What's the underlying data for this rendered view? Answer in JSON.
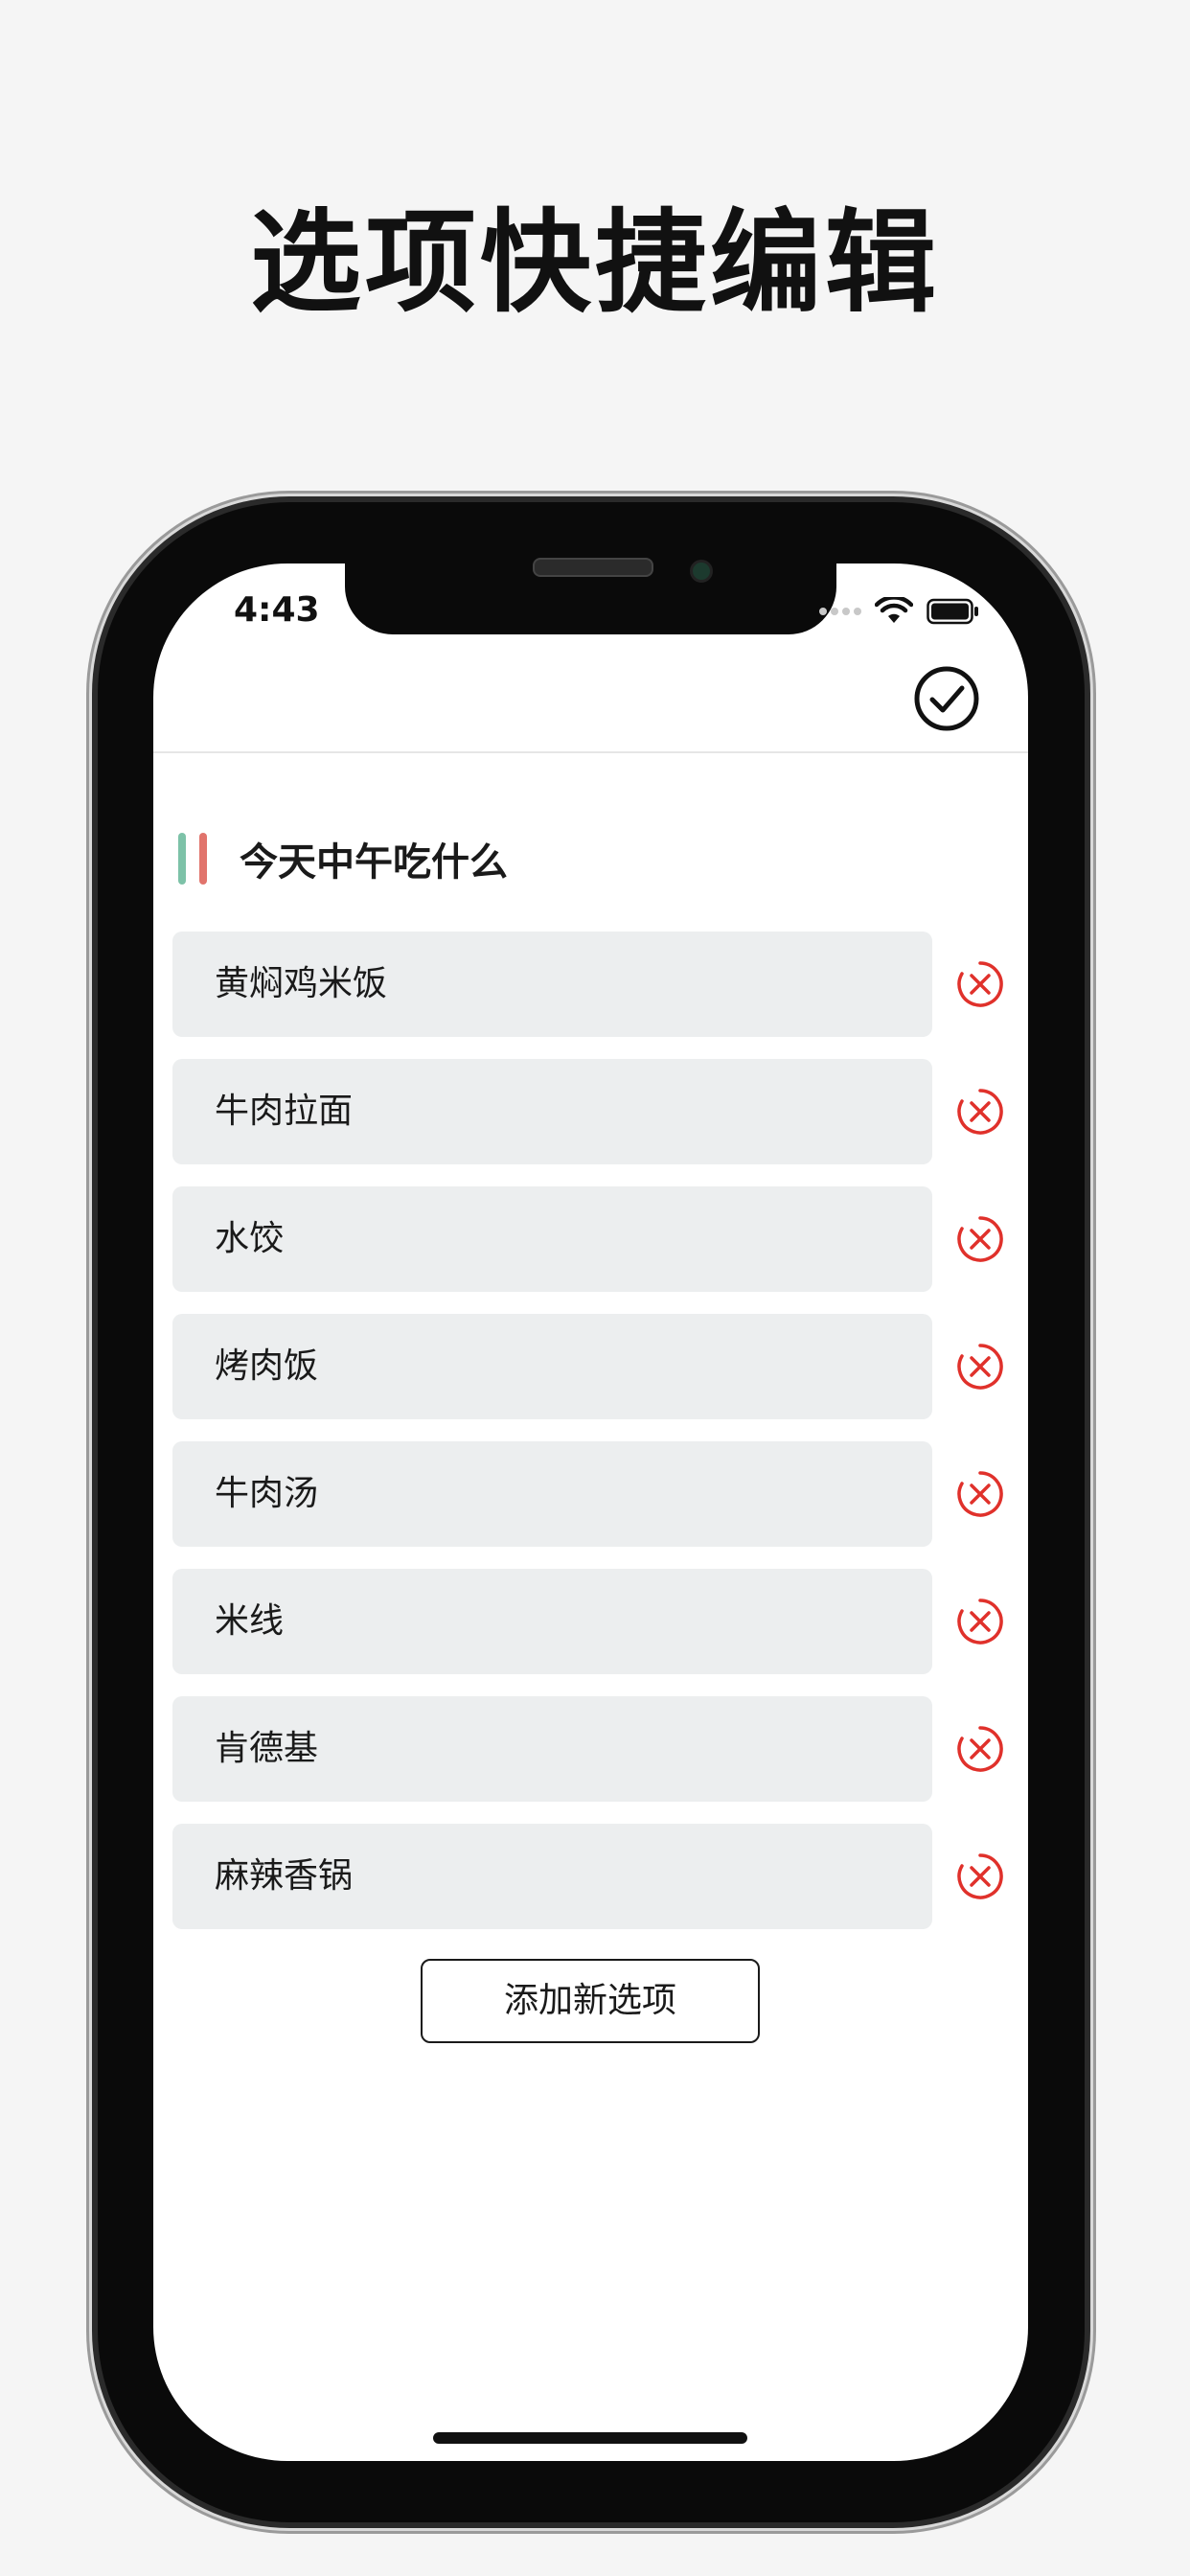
{
  "headline": "选项快捷编辑",
  "status_bar": {
    "time": "4:43"
  },
  "list": {
    "title": "今天中午吃什么",
    "marker_colors": [
      "#7dc2a8",
      "#e1746c"
    ],
    "options": [
      {
        "label": "黄焖鸡米饭"
      },
      {
        "label": "牛肉拉面"
      },
      {
        "label": "水饺"
      },
      {
        "label": "烤肉饭"
      },
      {
        "label": "牛肉汤"
      },
      {
        "label": "米线"
      },
      {
        "label": "肯德基"
      },
      {
        "label": "麻辣香锅"
      }
    ],
    "add_button_label": "添加新选项"
  },
  "colors": {
    "delete_accent": "#e0312b",
    "field_background": "#eceeef"
  },
  "icons": {
    "confirm": "checkmark-circle-icon",
    "delete": "close-circle-icon",
    "wifi": "wifi-icon",
    "battery": "battery-icon"
  }
}
